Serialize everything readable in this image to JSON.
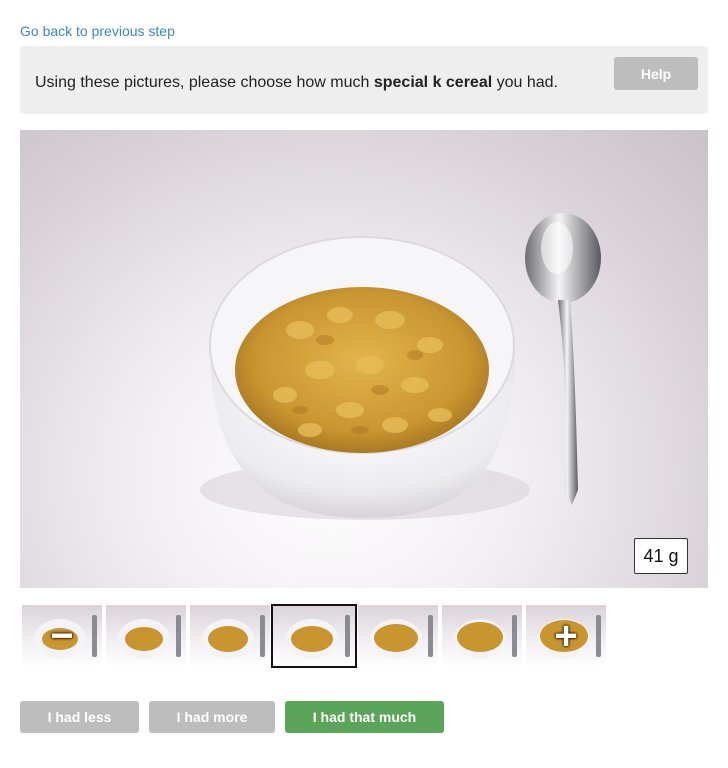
{
  "nav": {
    "back_label": "Go back to previous step"
  },
  "prompt": {
    "text_before": "Using these pictures, please choose how much ",
    "food_name": "special k cereal",
    "text_after": " you had.",
    "help_label": "Help"
  },
  "photo": {
    "weight_label": "41 g"
  },
  "thumbnails": {
    "selected_index": 3,
    "decrease_symbol": "−",
    "increase_symbol": "+"
  },
  "actions": {
    "less_label": "I had less",
    "more_label": "I had more",
    "that_label": "I had that much"
  },
  "colors": {
    "link": "#3a87c8",
    "disabled_button": "#bdbdbd",
    "confirm_button": "#5aa55a",
    "cereal": "#d9a637"
  }
}
